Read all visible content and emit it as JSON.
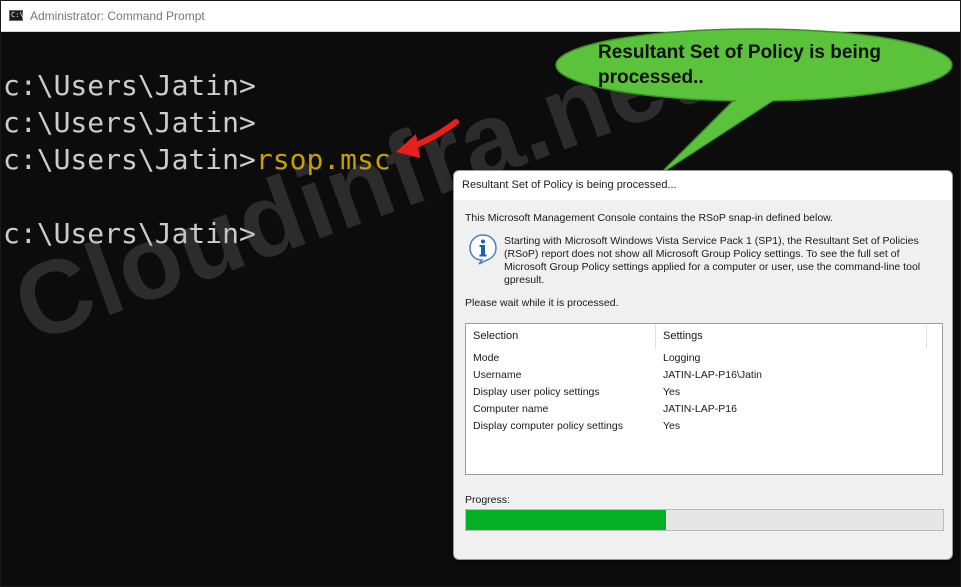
{
  "window": {
    "title": "Administrator: Command Prompt",
    "icon": "cmd-icon",
    "icon_text": "C:\\."
  },
  "console": {
    "lines": [
      {
        "prompt": "c:\\Users\\Jatin>",
        "command": ""
      },
      {
        "prompt": "c:\\Users\\Jatin>",
        "command": ""
      },
      {
        "prompt": "c:\\Users\\Jatin>",
        "command": "rsop.msc"
      },
      {
        "prompt": "c:\\Users\\Jatin>",
        "command": ""
      }
    ],
    "command_color": "#c4a000",
    "text_color": "#cccccc"
  },
  "watermark": "Cloudinfra.net",
  "callout": {
    "text": "Resultant Set of Policy is being processed..",
    "fill": "#5bc23c"
  },
  "annotation_arrow": {
    "color": "#e8201c",
    "icon": "red-arrow"
  },
  "dialog": {
    "title": "Resultant Set of Policy is being processed...",
    "intro": "This Microsoft Management Console contains the RSoP snap-in defined below.",
    "note_icon": "info-icon",
    "note": "Starting with Microsoft Windows Vista Service Pack 1 (SP1), the Resultant Set of Policies (RSoP) report does not show all Microsoft Group Policy settings. To see the full set of Microsoft Group Policy settings applied for a computer or user, use the command-line tool gpresult.",
    "wait": "Please wait while it is processed.",
    "table": {
      "columns": [
        "Selection",
        "Settings"
      ],
      "rows": [
        [
          "Mode",
          "Logging"
        ],
        [
          "Username",
          "JATIN-LAP-P16\\Jatin"
        ],
        [
          "Display user policy settings",
          "Yes"
        ],
        [
          "Computer name",
          "JATIN-LAP-P16"
        ],
        [
          "Display computer policy settings",
          "Yes"
        ]
      ]
    },
    "progress_label": "Progress:",
    "progress_fraction": 0.42,
    "progress_color": "#06b025"
  }
}
